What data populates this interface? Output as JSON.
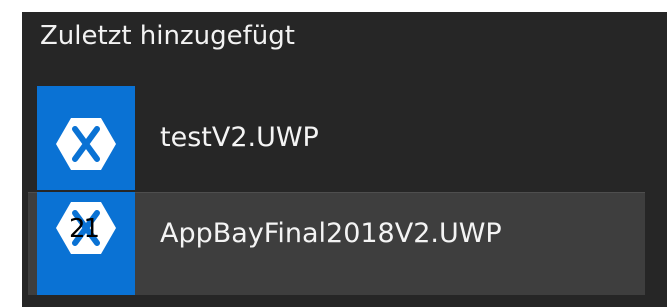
{
  "start_menu": {
    "section_title": "Zuletzt hinzugefügt",
    "apps": [
      {
        "label": "testV2.UWP",
        "icon": "xamarin-icon",
        "tile_color": "#0a72d4"
      },
      {
        "label": "AppBayFinal2018V2.UWP",
        "icon": "xamarin-icon",
        "tile_color": "#0a72d4",
        "badge": "21",
        "state": "hovered"
      }
    ]
  }
}
